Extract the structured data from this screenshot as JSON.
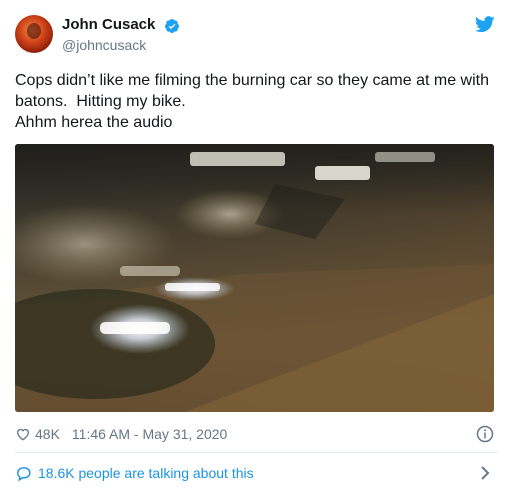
{
  "tweet": {
    "author_name": "John Cusack",
    "author_handle": "@johncusack",
    "text_lines": [
      "Cops didn’t like me filming the burning car so they came at me with",
      "batons.  Hitting my bike.",
      "Ahhm herea the audio"
    ],
    "likes": "48K",
    "timestamp": "11:46 AM - May 31, 2020",
    "conversation_text": "18.6K people are talking about this"
  },
  "icons": {
    "verified": "verified-badge-icon",
    "brand": "twitter-bird-icon",
    "like": "heart-icon",
    "info": "info-icon",
    "reply": "speech-bubble-icon",
    "chevron": "chevron-right-icon"
  },
  "colors": {
    "accent": "#1da1f2",
    "link": "#1b95e0",
    "secondary_text": "#657786",
    "primary_text": "#14171a"
  }
}
